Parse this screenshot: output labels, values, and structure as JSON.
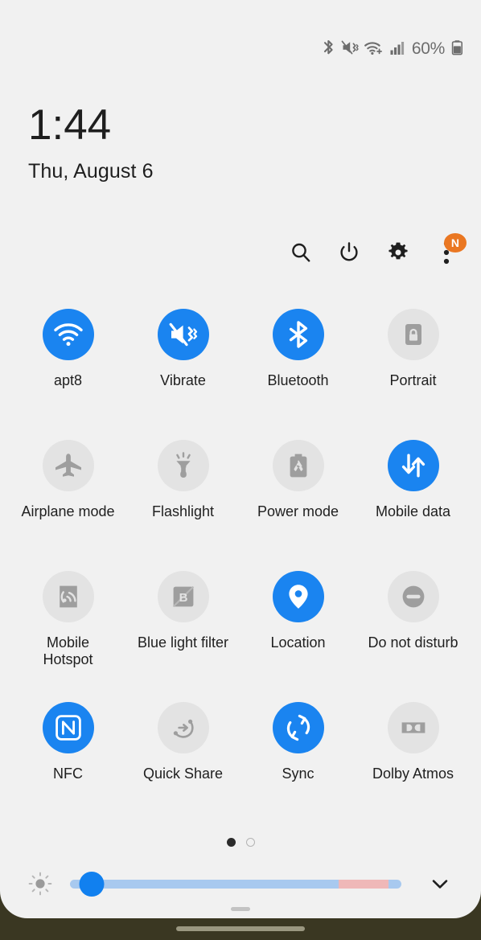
{
  "statusbar": {
    "icons": [
      "bluetooth-icon",
      "vibrate-icon",
      "wifi-icon",
      "signal-icon"
    ],
    "battery_percent": "60%",
    "battery_icon": "battery-icon"
  },
  "clock": {
    "time": "1:44",
    "date": "Thu, August 6"
  },
  "toolbar": {
    "search_label": "Search",
    "power_label": "Power off",
    "settings_label": "Settings",
    "more_label": "More options",
    "badge_text": "N"
  },
  "tiles": [
    {
      "label": "apt8",
      "icon": "wifi-icon",
      "state": "on"
    },
    {
      "label": "Vibrate",
      "icon": "vibrate-icon",
      "state": "on"
    },
    {
      "label": "Bluetooth",
      "icon": "bluetooth-icon",
      "state": "on"
    },
    {
      "label": "Portrait",
      "icon": "rotation-lock-icon",
      "state": "off"
    },
    {
      "label": "Airplane mode",
      "icon": "airplane-icon",
      "state": "off"
    },
    {
      "label": "Flashlight",
      "icon": "flashlight-icon",
      "state": "off"
    },
    {
      "label": "Power mode",
      "icon": "power-mode-icon",
      "state": "off"
    },
    {
      "label": "Mobile data",
      "icon": "mobile-data-icon",
      "state": "on"
    },
    {
      "label": "Mobile Hotspot",
      "icon": "hotspot-icon",
      "state": "off"
    },
    {
      "label": "Blue light filter",
      "icon": "blue-light-icon",
      "state": "off"
    },
    {
      "label": "Location",
      "icon": "location-pin-icon",
      "state": "on"
    },
    {
      "label": "Do not disturb",
      "icon": "do-not-disturb-icon",
      "state": "off"
    },
    {
      "label": "NFC",
      "icon": "nfc-icon",
      "state": "on"
    },
    {
      "label": "Quick Share",
      "icon": "quick-share-icon",
      "state": "off"
    },
    {
      "label": "Sync",
      "icon": "sync-icon",
      "state": "on"
    },
    {
      "label": "Dolby Atmos",
      "icon": "dolby-atmos-icon",
      "state": "off"
    }
  ],
  "pager": {
    "current_page": 1,
    "total_pages": 2
  },
  "brightness": {
    "icon": "brightness-sun-icon",
    "value_percent": 3,
    "warm_start_percent": 81,
    "warm_end_percent": 96,
    "expand_icon": "chevron-down-icon"
  },
  "colors": {
    "active_tile": "#1a84f0",
    "inactive_tile": "#e3e3e3",
    "inactive_glyph": "#9e9e9e",
    "badge": "#ea7722",
    "panel_bg": "#f1f1f1",
    "slider_track": "#a8c9ef",
    "slider_warm": "#efb8b8",
    "slider_thumb": "#1180ef",
    "navbar_bg": "#3a3722"
  }
}
